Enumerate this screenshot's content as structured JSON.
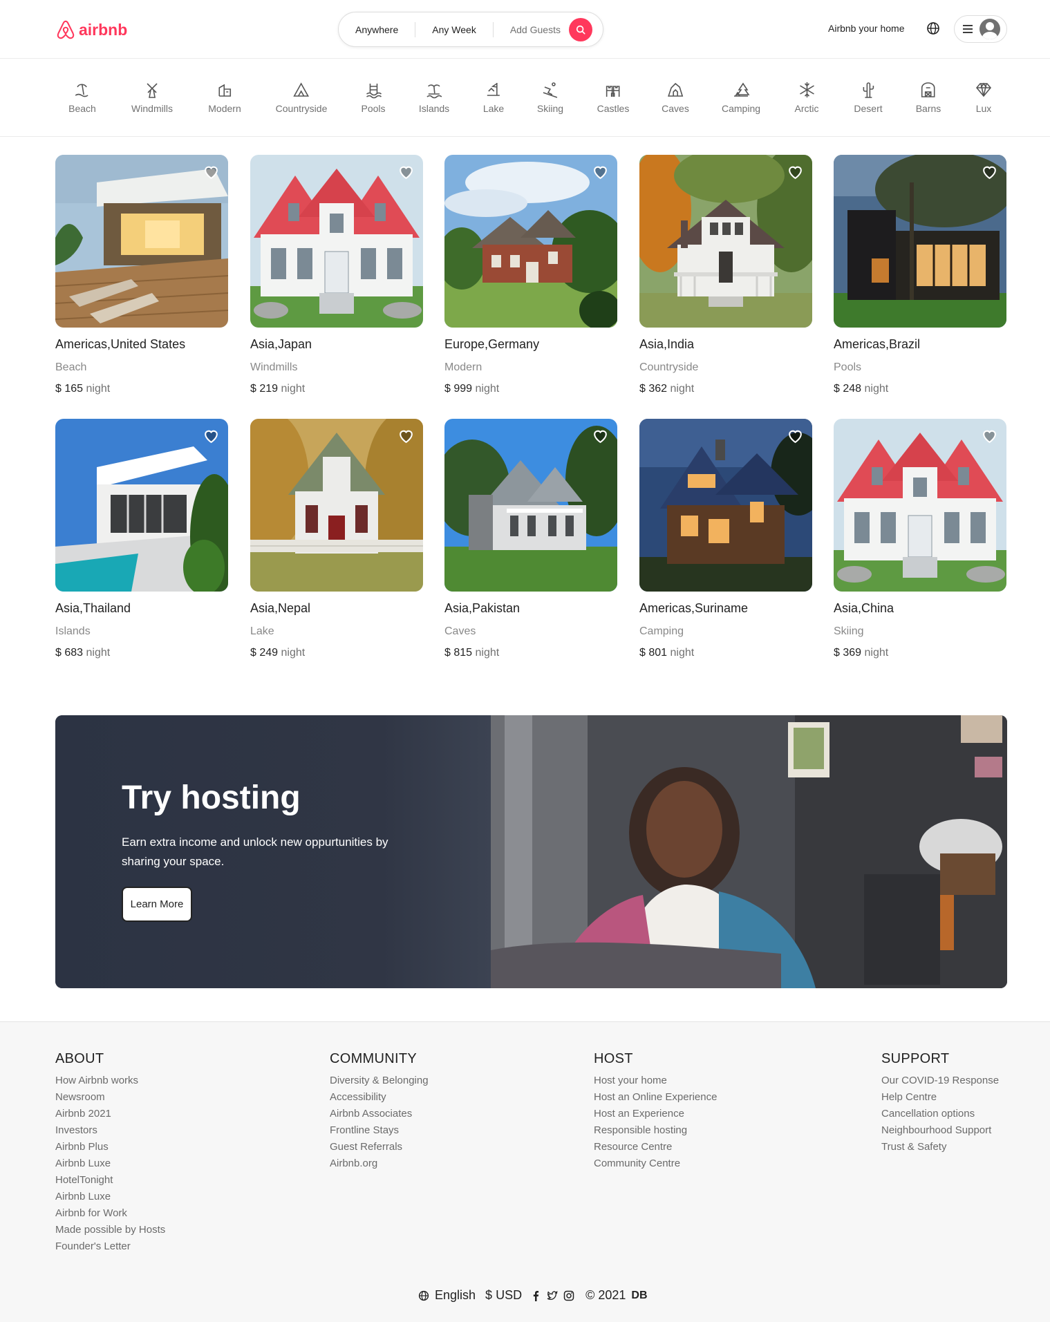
{
  "brand": {
    "name": "airbnb",
    "color": "#ff385c"
  },
  "search": {
    "where": "Anywhere",
    "when": "Any Week",
    "guests": "Add Guests"
  },
  "header": {
    "host_link": "Airbnb your home"
  },
  "categories": [
    {
      "label": "Beach",
      "icon": "beach-icon"
    },
    {
      "label": "Windmills",
      "icon": "windmill-icon"
    },
    {
      "label": "Modern",
      "icon": "modern-icon"
    },
    {
      "label": "Countryside",
      "icon": "countryside-icon"
    },
    {
      "label": "Pools",
      "icon": "pool-icon"
    },
    {
      "label": "Islands",
      "icon": "island-icon"
    },
    {
      "label": "Lake",
      "icon": "lake-icon"
    },
    {
      "label": "Skiing",
      "icon": "skiing-icon"
    },
    {
      "label": "Castles",
      "icon": "castle-icon"
    },
    {
      "label": "Caves",
      "icon": "cave-icon"
    },
    {
      "label": "Camping",
      "icon": "camping-icon"
    },
    {
      "label": "Arctic",
      "icon": "snowflake-icon"
    },
    {
      "label": "Desert",
      "icon": "cactus-icon"
    },
    {
      "label": "Barns",
      "icon": "barn-icon"
    },
    {
      "label": "Lux",
      "icon": "diamond-icon"
    }
  ],
  "listings": [
    {
      "location": "Americas,United States",
      "type": "Beach",
      "price": "$ 165",
      "unit": "night"
    },
    {
      "location": "Asia,Japan",
      "type": "Windmills",
      "price": "$ 219",
      "unit": "night"
    },
    {
      "location": "Europe,Germany",
      "type": "Modern",
      "price": "$ 999",
      "unit": "night"
    },
    {
      "location": "Asia,India",
      "type": "Countryside",
      "price": "$ 362",
      "unit": "night"
    },
    {
      "location": "Americas,Brazil",
      "type": "Pools",
      "price": "$ 248",
      "unit": "night"
    },
    {
      "location": "Asia,Thailand",
      "type": "Islands",
      "price": "$ 683",
      "unit": "night"
    },
    {
      "location": "Asia,Nepal",
      "type": "Lake",
      "price": "$ 249",
      "unit": "night"
    },
    {
      "location": "Asia,Pakistan",
      "type": "Caves",
      "price": "$ 815",
      "unit": "night"
    },
    {
      "location": "Americas,Suriname",
      "type": "Camping",
      "price": "$ 801",
      "unit": "night"
    },
    {
      "location": "Asia,China",
      "type": "Skiing",
      "price": "$ 369",
      "unit": "night"
    }
  ],
  "hosting": {
    "title": "Try hosting",
    "text": "Earn extra income and unlock new oppurtunities by sharing your space.",
    "button": "Learn More"
  },
  "footer": {
    "columns": [
      {
        "title": "ABOUT",
        "links": [
          "How Airbnb works",
          "Newsroom",
          "Airbnb 2021",
          "Investors",
          "Airbnb Plus",
          "Airbnb Luxe",
          "HotelTonight",
          "Airbnb Luxe",
          "Airbnb for Work",
          "Made possible by Hosts",
          "Founder's Letter"
        ]
      },
      {
        "title": "COMMUNITY",
        "links": [
          "Diversity & Belonging",
          "Accessibility",
          "Airbnb Associates",
          "Frontline Stays",
          "Guest Referrals",
          "Airbnb.org"
        ]
      },
      {
        "title": "HOST",
        "links": [
          "Host your home",
          "Host an Online Experience",
          "Host an Experience",
          "Responsible hosting",
          "Resource Centre",
          "Community Centre"
        ]
      },
      {
        "title": "SUPPORT",
        "links": [
          "Our COVID-19 Response",
          "Help Centre",
          "Cancellation options",
          "Neighbourhood Support",
          "Trust & Safety"
        ]
      }
    ],
    "language": "English",
    "currency": "USD",
    "currency_symbol": "$",
    "copyright": "© 2021",
    "copyright_mark": "DB"
  }
}
